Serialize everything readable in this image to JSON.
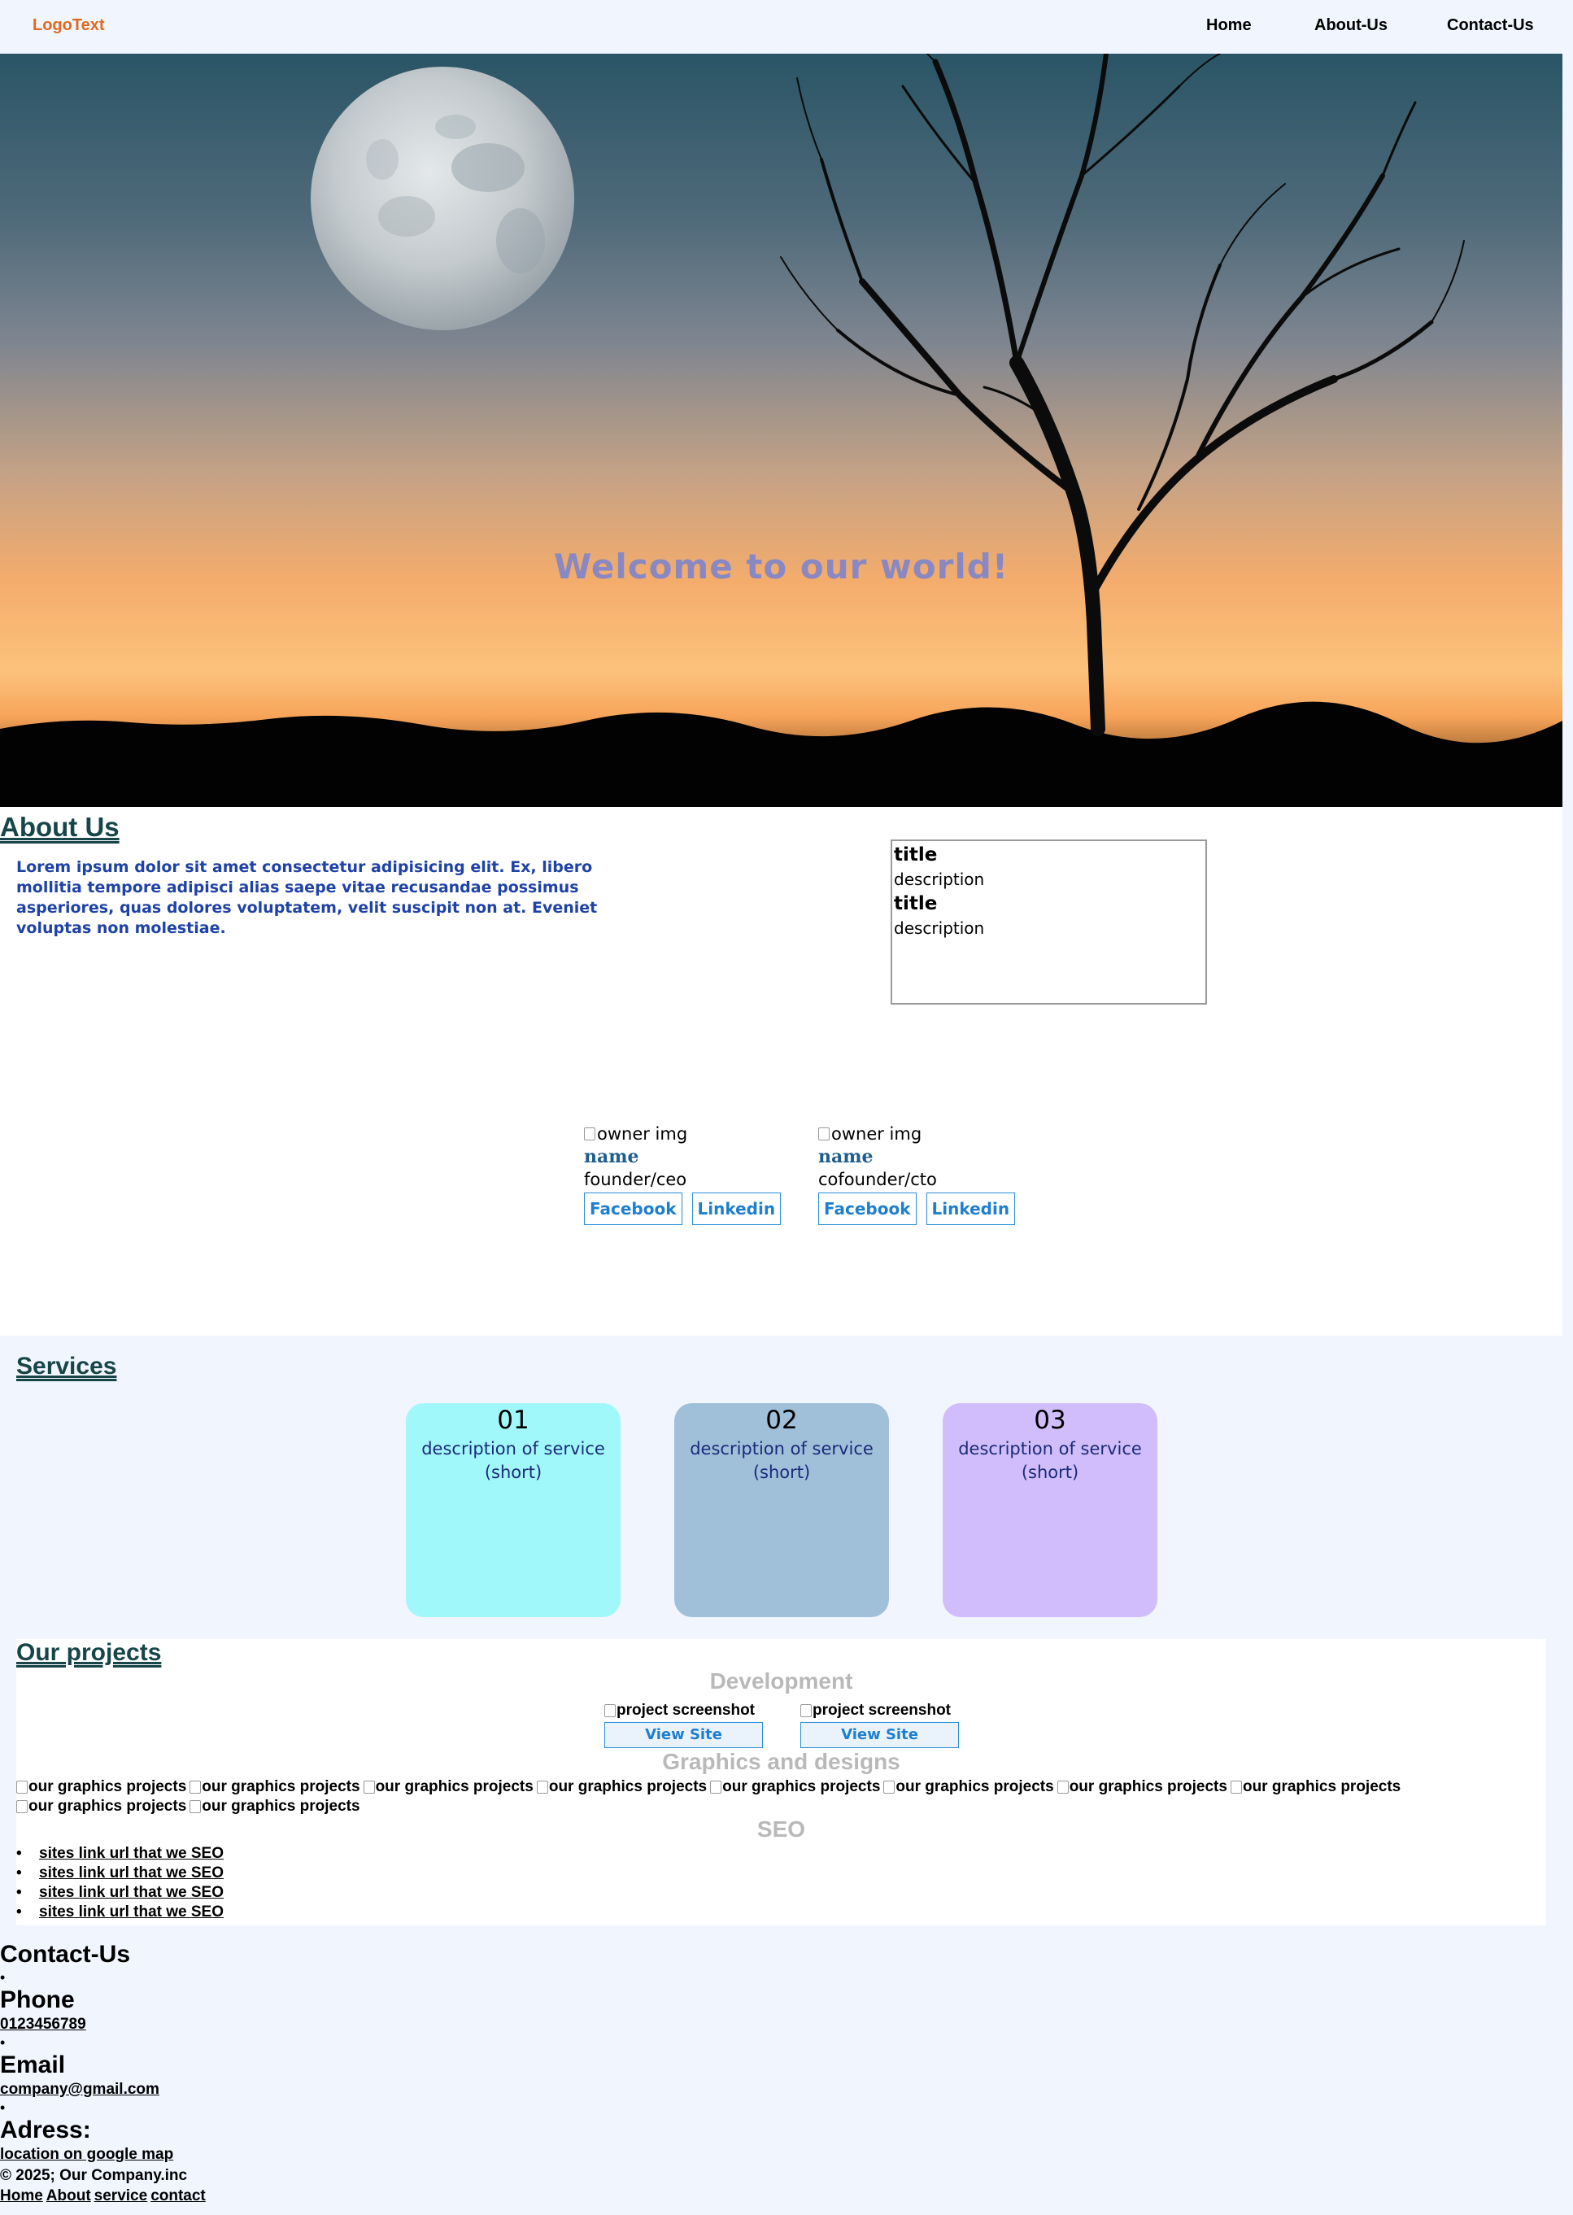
{
  "nav": {
    "logo": "LogoText",
    "links": [
      "Home",
      "About-Us",
      "Contact-Us"
    ]
  },
  "hero": {
    "headline": "Welcome to our world!"
  },
  "about": {
    "title": "About Us",
    "text": "Lorem ipsum dolor sit amet consectetur adipisicing elit. Ex, libero mollitia tempore adipisci alias saepe vitae recusandae possimus asperiores, quas dolores voluptatem, velit suscipit non at. Eveniet voluptas non molestiae.",
    "info": [
      {
        "title": "title",
        "description": "description"
      },
      {
        "title": "title",
        "description": "description"
      }
    ],
    "owners": [
      {
        "img_alt": "owner img",
        "name": "name",
        "role": "founder/ceo",
        "facebook": "Facebook",
        "linkedin": "Linkedin"
      },
      {
        "img_alt": "owner img",
        "name": "name",
        "role": "cofounder/cto",
        "facebook": "Facebook",
        "linkedin": "Linkedin"
      }
    ]
  },
  "services": {
    "title": "Services",
    "cards": [
      {
        "num": "01",
        "desc": "description of service (short)",
        "color": "#a0f8fa"
      },
      {
        "num": "02",
        "desc": "description of service (short)",
        "color": "#a0bfd9"
      },
      {
        "num": "03",
        "desc": "description of service (short)",
        "color": "#d1bdfb"
      }
    ]
  },
  "projects": {
    "title": "Our projects",
    "development": {
      "title": "Development",
      "items": [
        {
          "img_alt": "project screenshot",
          "button": "View Site"
        },
        {
          "img_alt": "project screenshot",
          "button": "View Site"
        }
      ]
    },
    "graphics": {
      "title": "Graphics and designs",
      "items": [
        "our graphics projects",
        "our graphics projects",
        "our graphics projects",
        "our graphics projects",
        "our graphics projects",
        "our graphics projects",
        "our graphics projects",
        "our graphics projects",
        "our graphics projects",
        "our graphics projects"
      ]
    },
    "seo": {
      "title": "SEO",
      "links": [
        "sites link url that we SEO",
        "sites link url that we SEO",
        "sites link url that we SEO",
        "sites link url that we SEO"
      ]
    }
  },
  "contact": {
    "title": "Contact-Us",
    "phone_label": "Phone",
    "phone": "0123456789",
    "email_label": "Email",
    "email": "company@gmail.com",
    "address_label": "Adress:",
    "address": "location on google map"
  },
  "footer": {
    "copyright": "© 2025; Our Company.inc",
    "links": [
      "Home",
      "About",
      "service",
      "contact"
    ]
  }
}
